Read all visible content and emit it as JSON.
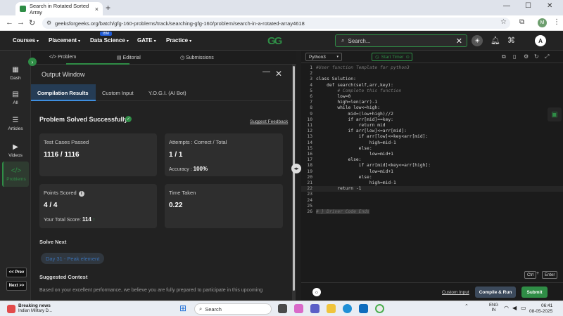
{
  "browser": {
    "tab_title": "Search in Rotated Sorted Array",
    "url": "geeksforgeeks.org/batch/gfg-160-problems/track/searching-gfg-160/problem/search-in-a-rotated-array4618",
    "profile_initial": "M"
  },
  "header": {
    "menus": [
      "Courses",
      "Placement",
      "Data Science",
      "GATE",
      "Practice"
    ],
    "ibm_badge": "IBM",
    "logo": "GG",
    "search_placeholder": "Search...",
    "avatar_initial": "A"
  },
  "sidebar": {
    "items": [
      {
        "label": "Dash",
        "icon": "dashboard-icon"
      },
      {
        "label": "All",
        "icon": "grid-icon"
      },
      {
        "label": "Articles",
        "icon": "articles-icon"
      },
      {
        "label": "Videos",
        "icon": "video-icon"
      },
      {
        "label": "Problems",
        "icon": "code-icon"
      }
    ],
    "prev": "<< Prev",
    "next": "Next >>"
  },
  "panel_tabs": [
    "Problem",
    "Editorial",
    "Submissions"
  ],
  "output": {
    "title": "Output Window",
    "tabs": [
      "Compilation Results",
      "Custom Input",
      "Y.O.G.I. (AI Bot)"
    ],
    "status": "Problem Solved Successfully",
    "feedback": "Suggest Feedback",
    "test_cases_label": "Test Cases Passed",
    "test_cases_value": "1116 / 1116",
    "attempts_label": "Attempts : Correct / Total",
    "attempts_value": "1 / 1",
    "accuracy_label": "Accuracy :",
    "accuracy_value": "100%",
    "points_label": "Points Scored",
    "points_value": "4 / 4",
    "total_score_label": "Your Total Score:",
    "total_score_value": "114",
    "time_label": "Time Taken",
    "time_value": "0.22",
    "solve_next_label": "Solve Next",
    "solve_next_item": "Day 31 - Peak element",
    "suggested_contest_label": "Suggested Contest",
    "contest_text": "Based on your excellent performance, we believe you are fully prepared to participate in this upcoming"
  },
  "editor": {
    "language": "Python3",
    "timer_label": "Start Timer",
    "lines": [
      "#User function Template for python3",
      "",
      "class Solution:",
      "    def search(self,arr,key):",
      "        # Complete this function",
      "        low=0",
      "        high=len(arr)-1",
      "        while low<=high:",
      "            mid=(low+high)//2",
      "            if arr[mid]==key:",
      "                return mid",
      "            if arr[low]<=arr[mid]:",
      "                if arr[low]<=key<arr[mid]:",
      "                    high=mid-1",
      "                else:",
      "                    low=mid+1",
      "            else:",
      "                if arr[mid]<key<=arr[high]:",
      "                    low=mid+1",
      "                else:",
      "                    high=mid-1",
      "        return -1",
      "",
      "",
      "",
      "# } Driver Code Ends"
    ],
    "kbd_ctrl": "Ctrl",
    "kbd_enter": "Enter",
    "custom_input": "Custom Input",
    "compile_run": "Compile & Run",
    "submit": "Submit"
  },
  "taskbar": {
    "news_title": "Breaking news",
    "news_sub": "Indian Military D...",
    "search": "Search",
    "lang_top": "ENG",
    "lang_bottom": "IN",
    "time": "06:41",
    "date": "08-05-2025"
  },
  "colors": {
    "accent_green": "#2f8d46",
    "active_tab_blue": "#253c55"
  }
}
